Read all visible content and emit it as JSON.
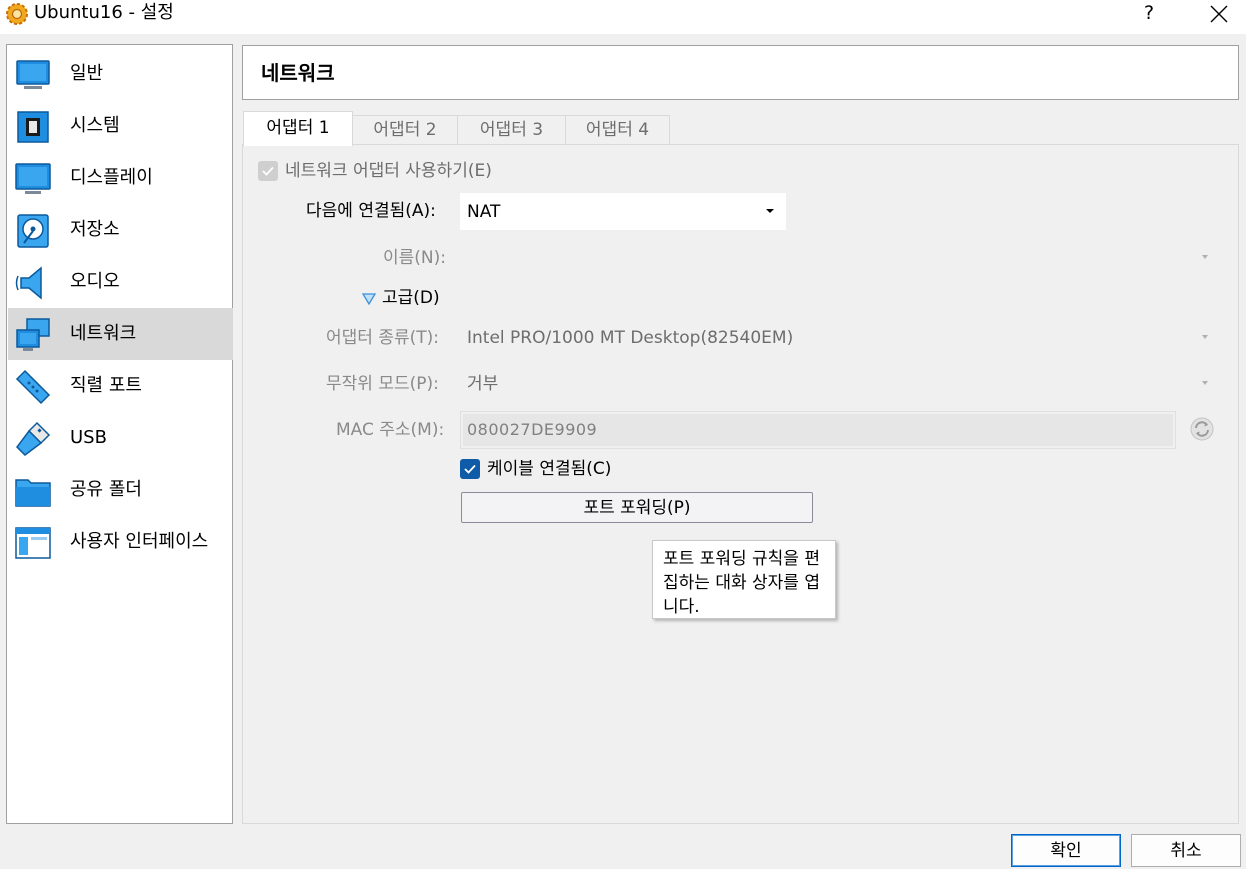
{
  "window": {
    "title": "Ubuntu16 - 설정",
    "help_label": "?",
    "app_icon": "virtualbox-gear-icon",
    "close_icon": "close-icon"
  },
  "sidebar": {
    "items": [
      {
        "label": "일반",
        "icon": "general-monitor-icon",
        "selected": false
      },
      {
        "label": "시스템",
        "icon": "system-chip-icon",
        "selected": false
      },
      {
        "label": "디스플레이",
        "icon": "display-monitor-icon",
        "selected": false
      },
      {
        "label": "저장소",
        "icon": "storage-disk-icon",
        "selected": false
      },
      {
        "label": "오디오",
        "icon": "audio-speaker-icon",
        "selected": false
      },
      {
        "label": "네트워크",
        "icon": "network-icon",
        "selected": true
      },
      {
        "label": "직렬 포트",
        "icon": "serial-port-icon",
        "selected": false
      },
      {
        "label": "USB",
        "icon": "usb-icon",
        "selected": false
      },
      {
        "label": "공유 폴더",
        "icon": "shared-folder-icon",
        "selected": false
      },
      {
        "label": "사용자 인터페이스",
        "icon": "user-interface-icon",
        "selected": false
      }
    ]
  },
  "header": {
    "title": "네트워크"
  },
  "tabs": [
    {
      "label": "어댑터 1",
      "active": true
    },
    {
      "label": "어댑터 2",
      "active": false
    },
    {
      "label": "어댑터 3",
      "active": false
    },
    {
      "label": "어댑터 4",
      "active": false
    }
  ],
  "adapter": {
    "enable_label": "네트워크 어댑터 사용하기(E)",
    "enabled": true,
    "attached_label": "다음에 연결됨(A):",
    "attached_value": "NAT",
    "name_label": "이름(N):",
    "name_value": "",
    "advanced_label": "고급(D)",
    "type_label": "어댑터 종류(T):",
    "type_value": "Intel PRO/1000 MT Desktop(82540EM)",
    "promisc_label": "무작위 모드(P):",
    "promisc_value": "거부",
    "mac_label": "MAC 주소(M):",
    "mac_value": "080027DE9909",
    "cable_label": "케이블 연결됨(C)",
    "cable_connected": true,
    "port_forwarding_label": "포트 포워딩(P)",
    "tooltip": "포트 포워딩 규칙을 편집하는 대화 상자를 엽니다."
  },
  "footer": {
    "ok_label": "확인",
    "cancel_label": "취소"
  },
  "colors": {
    "accent": "#0f5ba8",
    "selected_row": "#d9d9d9",
    "advanced_triangle": "#3c8fd6"
  }
}
